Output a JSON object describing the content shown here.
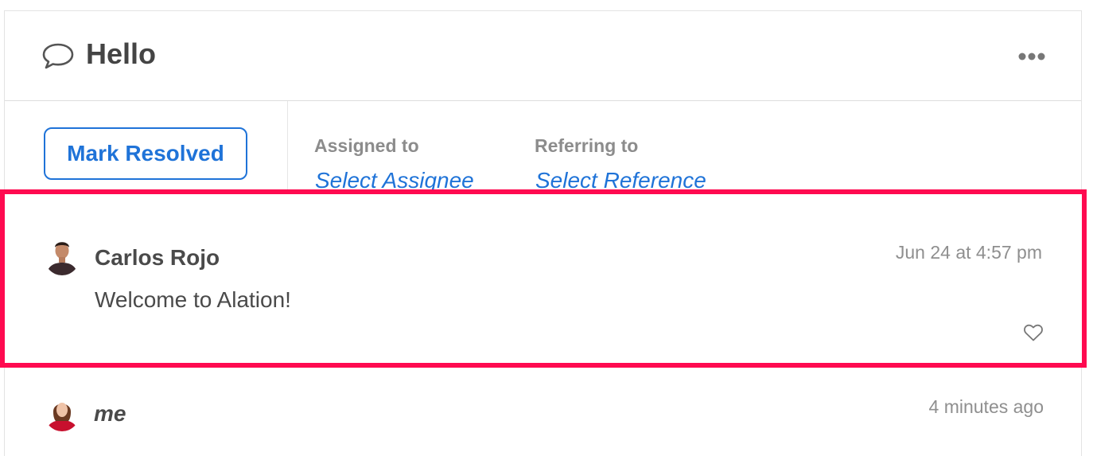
{
  "thread": {
    "title": "Hello",
    "icons": {
      "title": "speech-bubble-icon",
      "more": "more-options-icon"
    }
  },
  "actions": {
    "resolve_label": "Mark Resolved",
    "assigned_label": "Assigned to",
    "assigned_value": "Select Assignee",
    "referring_label": "Referring to",
    "referring_value": "Select Reference"
  },
  "comments": [
    {
      "author": "Carlos Rojo",
      "timestamp": "Jun 24 at 4:57 pm",
      "text": "Welcome to Alation!",
      "like_icon": "heart-icon",
      "highlighted": true
    },
    {
      "author": "me",
      "timestamp": "4 minutes ago"
    }
  ],
  "colors": {
    "accent": "#1f73d8",
    "highlight": "#ff0a50",
    "muted": "#8c8c8c",
    "text": "#4a4a4a"
  }
}
